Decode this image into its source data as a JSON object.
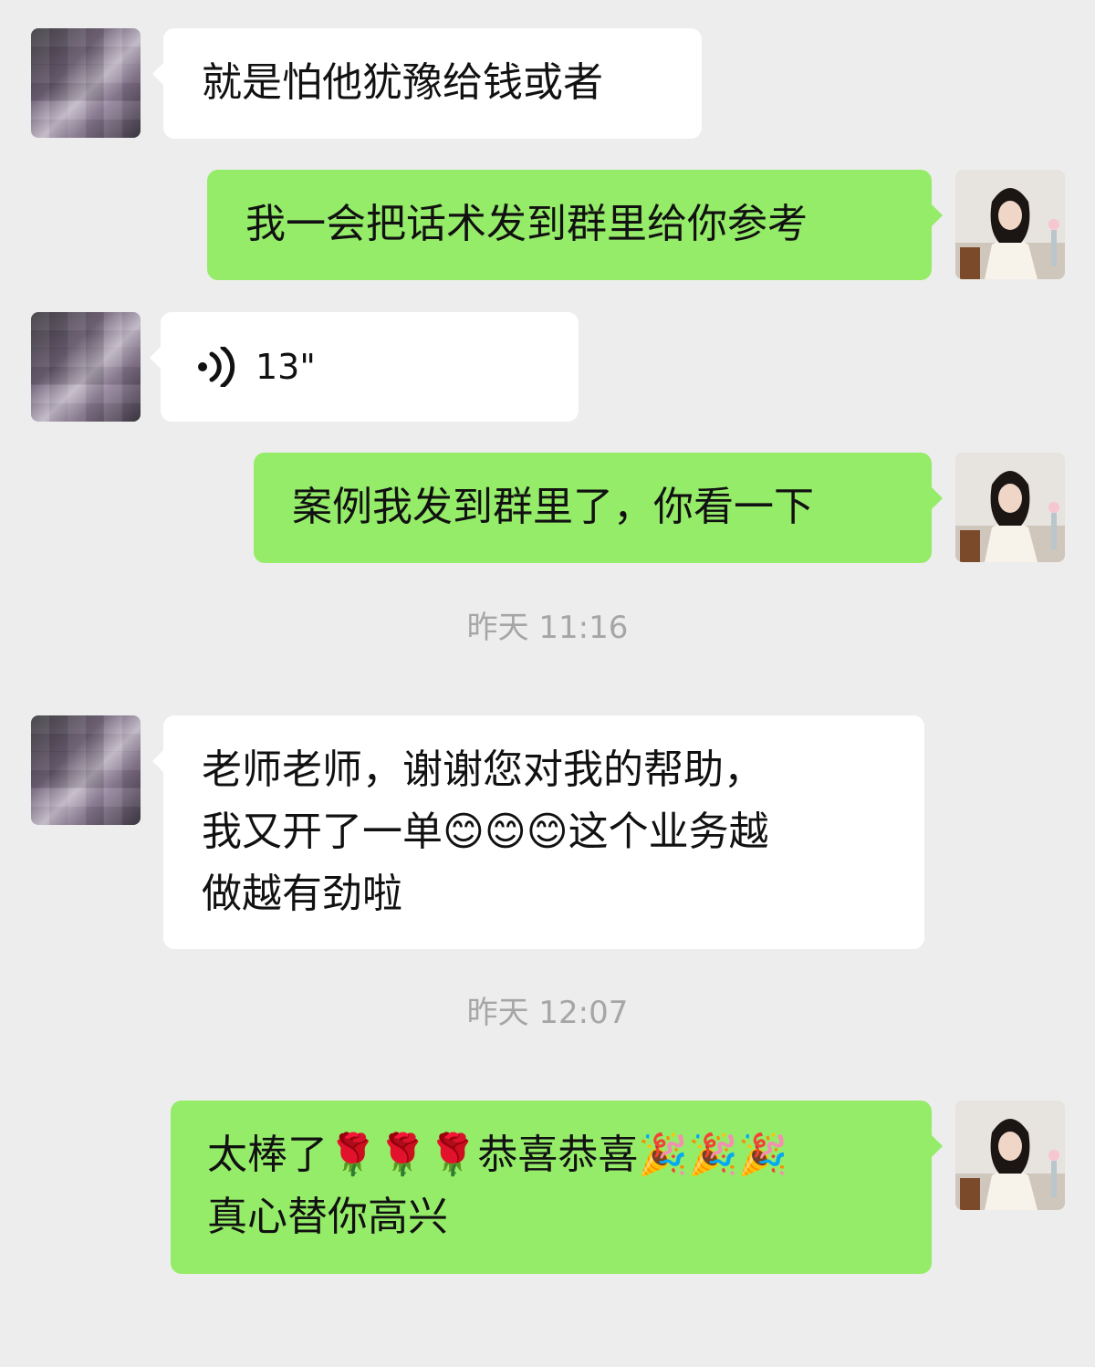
{
  "messages": [
    {
      "side": "left",
      "type": "text",
      "text": "就是怕他犹豫给钱或者"
    },
    {
      "side": "right",
      "type": "text",
      "text": "我一会把话术发到群里给你参考"
    },
    {
      "side": "left",
      "type": "voice",
      "duration": "13\""
    },
    {
      "side": "right",
      "type": "text",
      "text": "案例我发到群里了，你看一下"
    },
    {
      "type": "timestamp",
      "text": "昨天 11:16"
    },
    {
      "side": "left",
      "type": "text",
      "lines": [
        "老师老师，谢谢您对我的帮助，",
        "我又开了一单😊😊😊这个业务越",
        "做越有劲啦"
      ]
    },
    {
      "type": "timestamp",
      "text": "昨天 12:07"
    },
    {
      "side": "right",
      "type": "text",
      "lines": [
        "太棒了🌹🌹🌹恭喜恭喜🎉🎉🎉",
        "真心替你高兴"
      ]
    }
  ],
  "icons": {
    "voice": "voice-wave-icon"
  },
  "colors": {
    "background": "#ededed",
    "left_bubble": "#ffffff",
    "right_bubble": "#95ec69",
    "timestamp": "#a6a6a6"
  }
}
